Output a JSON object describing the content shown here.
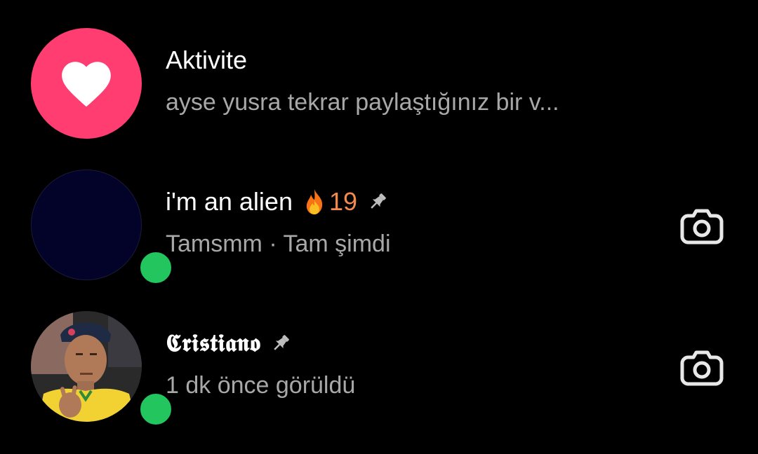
{
  "threads": [
    {
      "title": "Aktivite",
      "subtitle": "ayse yusra tekrar paylaştığınız bir v...",
      "avatar_icon": "heart-icon",
      "avatar_color": "#ff3d71"
    },
    {
      "title": "i'm an alien",
      "streak_icon": "fire-icon",
      "streak_count": "19",
      "pinned_icon": "pin-icon",
      "subtitle": "Tamsmm · Tam şimdi",
      "online": true,
      "action_icon": "camera-icon"
    },
    {
      "title": "𝕮𝖗𝖎𝖘𝖙𝖎𝖆𝖓𝖔",
      "pinned_icon": "pin-icon",
      "subtitle": "1 dk önce görüldü",
      "online": true,
      "action_icon": "camera-icon"
    }
  ],
  "colors": {
    "background": "#000000",
    "online": "#22c55e",
    "streak": "#f58a4f",
    "secondary_text": "#a8a8a8"
  }
}
